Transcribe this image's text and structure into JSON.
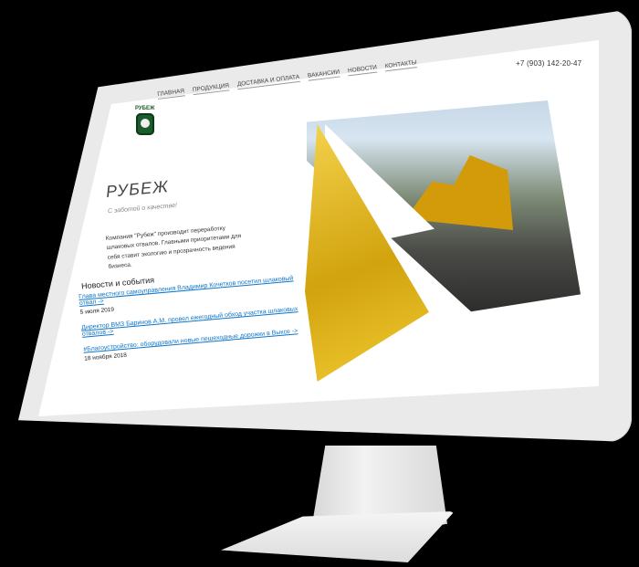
{
  "site": {
    "phone": "+7 (903) 142-20-47",
    "logo_text": "РУБЕЖ",
    "nav": [
      "ГЛАВНАЯ",
      "ПРОДУКЦИЯ",
      "ДОСТАВКА И ОПЛАТА",
      "ВАКАНСИИ",
      "НОВОСТИ",
      "КОНТАКТЫ"
    ],
    "hero": {
      "title": "РУБЕЖ",
      "tagline": "С заботой о качестве!"
    },
    "intro": "Компания \"Рубеж\" производит переработку шлаковых отвалов. Главными приоритетами для себя ставит экологию и прозрачность ведения бизнеса.",
    "news": {
      "title": "Новости и события",
      "items": [
        {
          "link": "Глава местного самоуправления Владимир Кочетков посетил шлаковый отвал ->",
          "date": "5 июля 2019"
        },
        {
          "link": "Директор ВМЗ Баринов А.М. провел ежегодный обход участка шлаковых отвалов ->",
          "date": ""
        },
        {
          "link": "#Благоустройство: оборудовали новые пешеходные дорожки в Выксе ->",
          "date": "18 ноября 2018"
        }
      ]
    }
  },
  "colors": {
    "link": "#0e75c9",
    "accent_yellow": "#d1a30e",
    "logo_green": "#1c5c2a"
  }
}
